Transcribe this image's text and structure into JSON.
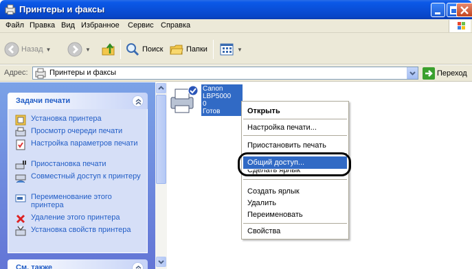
{
  "window": {
    "title": "Принтеры и факсы"
  },
  "menubar": {
    "items": [
      "Файл",
      "Правка",
      "Вид",
      "Избранное",
      "Сервис",
      "Справка"
    ]
  },
  "toolbar": {
    "back": "Назад",
    "search": "Поиск",
    "folders": "Папки"
  },
  "address": {
    "label": "Адрес:",
    "value": "Принтеры и факсы",
    "go": "Переход"
  },
  "tasks": {
    "title": "Задачи печати",
    "items": [
      "Установка принтера",
      "Просмотр очереди печати",
      "Настройка параметров печати",
      "Приостановка печати",
      "Совместный доступ к принтеру",
      "Переименование этого принтера",
      "Удаление этого принтера",
      "Установка свойств принтера"
    ],
    "see_also": "См. также"
  },
  "printer": {
    "name": "Canon LBP5000",
    "count": "0",
    "status": "Готов"
  },
  "context_menu": {
    "items": [
      "Открыть",
      "Настройка печати...",
      "Приостановить печать",
      "Общий доступ...",
      "Сделать ярлык",
      "Создать ярлык",
      "Удалить",
      "Переименовать",
      "Свойства"
    ]
  },
  "colors": {
    "titlebar": "#0a4fd8",
    "selection": "#316ac5",
    "task_link": "#215dc6",
    "left_pane": "#6f8ce0"
  }
}
